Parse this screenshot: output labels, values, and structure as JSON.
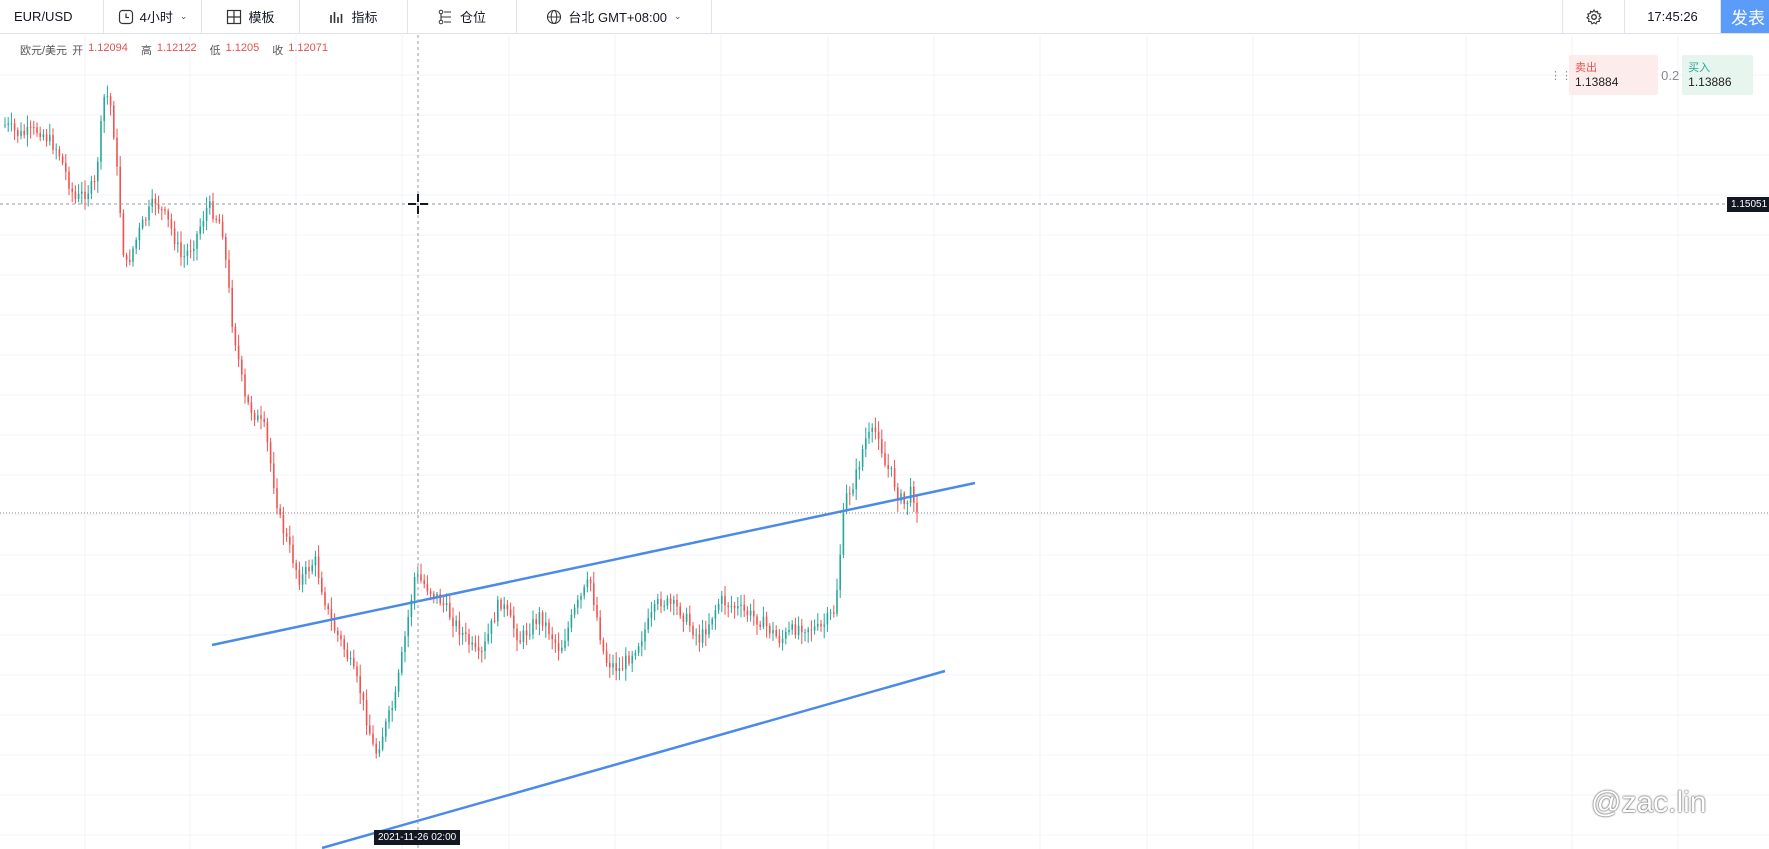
{
  "toolbar": {
    "symbol": "EUR/USD",
    "interval": "4小时",
    "template": "模板",
    "indicators": "指标",
    "positions": "仓位",
    "timezone": "台北 GMT+08:00",
    "clock": "17:45:26",
    "publish": "发表"
  },
  "ohlc": {
    "name": "欧元/美元",
    "open_label": "开",
    "open": "1.12094",
    "high_label": "高",
    "high": "1.12122",
    "low_label": "低",
    "low": "1.1205",
    "close_label": "收",
    "close": "1.12071"
  },
  "trade": {
    "sell_label": "卖出",
    "sell_price": "1.13884",
    "spread": "0.2",
    "buy_label": "买入",
    "buy_price": "1.13886"
  },
  "crosshair": {
    "price": "1.15051",
    "date": "2021-11-26 02:00"
  },
  "watermark": "@zac.lin",
  "colors": {
    "up": "#26a69a",
    "down": "#ef5350",
    "trendline": "#4a8ae8",
    "grid": "#f0f3fa",
    "accent": "#5b9cf8"
  },
  "icons": [
    "clock-icon",
    "chevron-down-icon",
    "template-icon",
    "indicator-icon",
    "position-icon",
    "globe-icon",
    "gear-icon",
    "grip-icon",
    "crosshair-icon"
  ]
}
